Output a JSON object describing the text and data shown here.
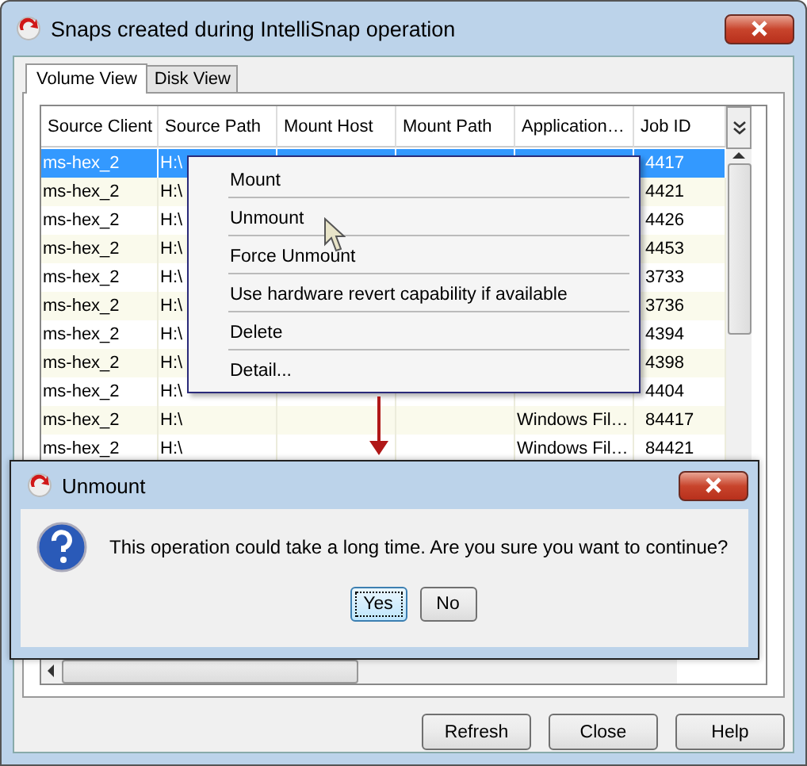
{
  "window": {
    "title": "Snaps created during IntelliSnap operation"
  },
  "tabs": [
    {
      "label": "Volume View",
      "selected": true
    },
    {
      "label": "Disk View",
      "selected": false
    }
  ],
  "table": {
    "columns": [
      "Source Client",
      "Source Path",
      "Mount Host",
      "Mount Path",
      "Application…",
      "Job ID"
    ],
    "rows": [
      {
        "source_client": "ms-hex_2",
        "source_path": "H:\\",
        "job_id": "4417",
        "selected": true
      },
      {
        "source_client": "ms-hex_2",
        "source_path": "H:\\",
        "job_id": "4421",
        "selected": false
      },
      {
        "source_client": "ms-hex_2",
        "source_path": "H:\\",
        "job_id": "4426",
        "selected": false
      },
      {
        "source_client": "ms-hex_2",
        "source_path": "H:\\",
        "job_id": "4453",
        "selected": false
      },
      {
        "source_client": "ms-hex_2",
        "source_path": "H:\\",
        "job_id": "3733",
        "selected": false
      },
      {
        "source_client": "ms-hex_2",
        "source_path": "H:\\",
        "job_id": "3736",
        "selected": false
      },
      {
        "source_client": "ms-hex_2",
        "source_path": "H:\\",
        "job_id": "4394",
        "selected": false
      },
      {
        "source_client": "ms-hex_2",
        "source_path": "H:\\",
        "job_id": "4398",
        "selected": false
      },
      {
        "source_client": "ms-hex_2",
        "source_path": "H:\\",
        "job_id": "4404",
        "selected": false
      },
      {
        "source_client": "ms-hex_2",
        "source_path": "H:\\",
        "application": "Windows Fil…",
        "job_id": "84417",
        "selected": false
      },
      {
        "source_client": "ms-hex_2",
        "source_path": "H:\\",
        "application": "Windows Fil…",
        "job_id": "84421",
        "selected": false
      }
    ]
  },
  "context_menu": {
    "items": [
      "Mount",
      "Unmount",
      "Force Unmount",
      "Use hardware revert capability if available",
      "Delete",
      "Detail..."
    ]
  },
  "dialog": {
    "title": "Unmount",
    "message": "This operation could take a long time. Are you sure you want to continue?",
    "buttons": [
      {
        "label": "Yes",
        "focused": true
      },
      {
        "label": "No",
        "focused": false
      }
    ]
  },
  "buttons": [
    "Refresh",
    "Close",
    "Help"
  ]
}
